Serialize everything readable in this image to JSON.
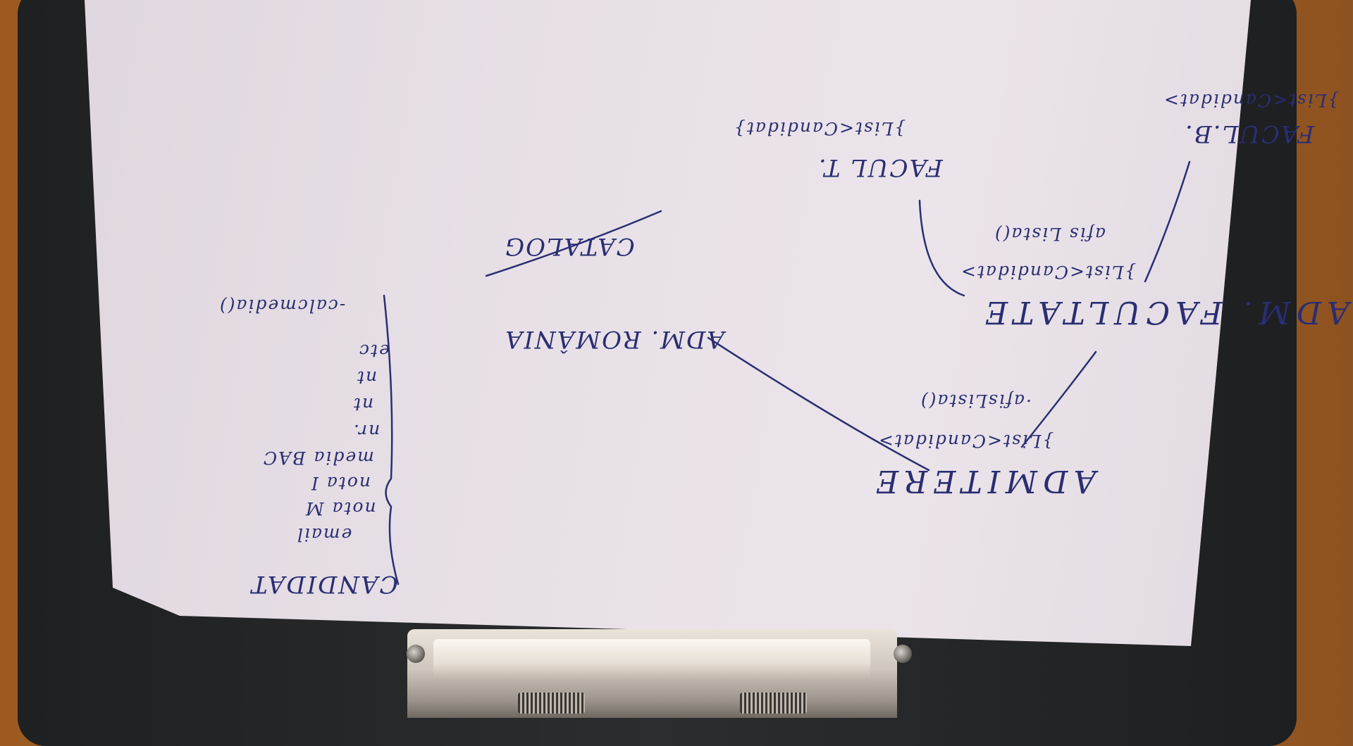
{
  "photo": {
    "subject": "clipboard with handwritten class diagram sheet",
    "handwriting": {
      "admitere": "ADMITERE",
      "admitere_list": "}List<Candidat>",
      "admitere_method": "·afisLista()",
      "facultate": "ADM. FACULTATE",
      "facultate_list": "}List<Candidat>",
      "facultate_method": "afis Lista()",
      "facultate_b": "FACUL.B.",
      "facultate_b_list": "}List<Candidat>",
      "facultate_t": "FACUL T.",
      "facultate_t_list": "}List<Candidat}",
      "romania": "ADM. ROMÂNIA",
      "catalog": "CATALOG",
      "candidat": "CANDIDAT",
      "candidat_fields": [
        "email",
        "nota M",
        "nota I",
        "media BAC",
        "nr.",
        "nt",
        "nt",
        "etc",
        "-calcmedia()"
      ]
    },
    "colors": {
      "ink": "#2a2e72",
      "paper": "#e7dfe6",
      "desk": "#a5642a",
      "board": "#25272a"
    }
  }
}
